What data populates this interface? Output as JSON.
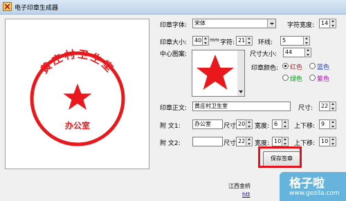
{
  "window": {
    "title": "电子印章生成器"
  },
  "seal": {
    "text": "黄庄村卫生室",
    "subtext": "办公室",
    "color": "#e8181c"
  },
  "form": {
    "font_label": "印章字体:",
    "font_value": "宋体",
    "char_width_label": "字符宽度:",
    "char_width_value": "14",
    "size_label": "印章大小:",
    "size_value": "40",
    "size_unit": "mm",
    "char_spacing_label": "字符:",
    "char_spacing_value": "21",
    "ring_label": "环线:",
    "ring_value": "5",
    "center_pic_label": "中心图案:",
    "pic_size_label": "尺寸大小:",
    "pic_size_value": "44",
    "color_label": "印章颜色:",
    "colors": [
      "红色",
      "蓝色",
      "绿色",
      "紫色"
    ],
    "body_label": "印章正文:",
    "body_value": "黄庄村卫生室",
    "body_size_label": "尺寸:",
    "body_size_value": "22",
    "sub1_label": "附   文1:",
    "sub1_value": "办公室",
    "sub1_size_label": "尺寸",
    "sub1_size_value": "20",
    "sub1_width_label": "宽度:",
    "sub1_width_value": "6",
    "sub1_shift_label": "上下移:",
    "sub1_shift_value": "9",
    "sub2_label": "附   文2:",
    "sub2_value": "",
    "sub2_size_label": "尺寸",
    "sub2_size_value": "22",
    "sub2_width_label": "宽度:",
    "sub2_width_value": "10",
    "sub2_shift_label": "上下移:",
    "sub2_shift_value": "10",
    "save_label": "保存签章"
  },
  "footer": {
    "company": "江西金桥",
    "link": "htt"
  },
  "watermark": {
    "name": "格子啦",
    "url": "www.gezila.com"
  }
}
